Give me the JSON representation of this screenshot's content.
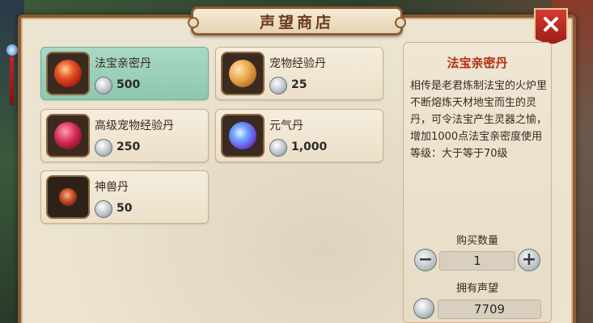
{
  "shop": {
    "title": "声望商店",
    "items": [
      {
        "name": "法宝亲密丹",
        "price": "500",
        "icon": "red-pill-icon",
        "color": "#d8321e"
      },
      {
        "name": "宠物经验丹",
        "price": "25",
        "icon": "orange-pills-icon",
        "color": "#e79a3c"
      },
      {
        "name": "高级宠物经验丹",
        "price": "250",
        "icon": "red-berries-icon",
        "color": "#c81f4a"
      },
      {
        "name": "元气丹",
        "price": "1,000",
        "icon": "blue-orb-icon",
        "color": "#4a7de8"
      },
      {
        "name": "神兽丹",
        "price": "50",
        "icon": "dark-red-flower-icon",
        "color": "#a4301a"
      }
    ]
  },
  "detail": {
    "title": "法宝亲密丹",
    "description": "相传是老君炼制法宝的火炉里不断熔炼天材地宝而生的灵丹，可令法宝产生灵器之愉，增加1000点法宝亲密度使用等级：大于等于70级",
    "qty_label": "购买数量",
    "quantity": "1",
    "reputation_label": "拥有声望",
    "reputation": "7709"
  },
  "colors": {
    "selected_bg": "#8ec7b0",
    "title_red": "#b43214",
    "frame": "#8c5a35"
  }
}
